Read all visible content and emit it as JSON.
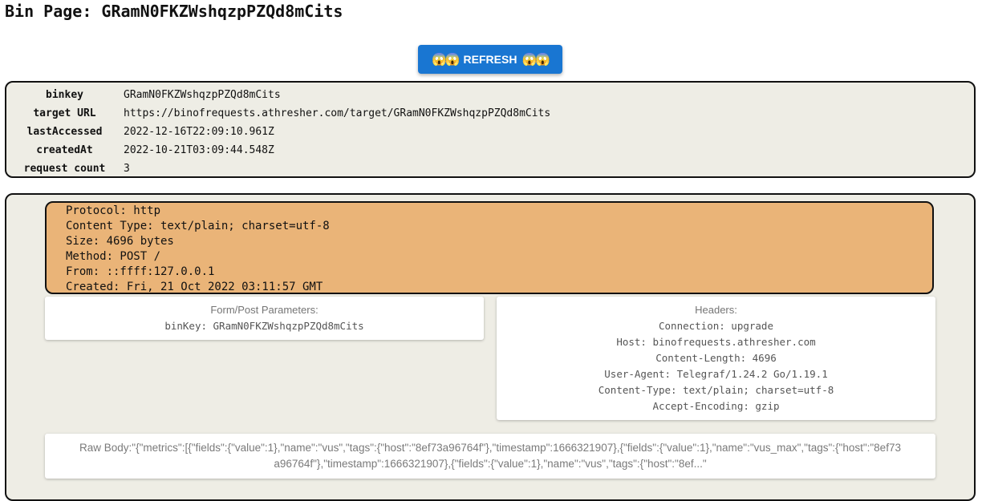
{
  "page_title": "Bin Page: GRamN0FKZWshqzpPZQd8mCits",
  "refresh_button": {
    "emoji": "😱😱",
    "label": "REFRESH"
  },
  "bin_info": [
    {
      "label": "binkey",
      "value": "GRamN0FKZWshqzpPZQd8mCits"
    },
    {
      "label": "target URL",
      "value": "https://binofrequests.athresher.com/target/GRamN0FKZWshqzpPZQd8mCits"
    },
    {
      "label": "lastAccessed",
      "value": "2022-12-16T22:09:10.961Z"
    },
    {
      "label": "createdAt",
      "value": "2022-10-21T03:09:44.548Z"
    },
    {
      "label": "request count",
      "value": "3"
    }
  ],
  "request": {
    "summary": [
      "Protocol: http",
      "Content Type: text/plain; charset=utf-8",
      "Size: 4696 bytes",
      "Method: POST /",
      "From: ::ffff:127.0.0.1",
      "Created: Fri, 21 Oct 2022 03:11:57 GMT"
    ],
    "form_params": {
      "title": "Form/Post Parameters:",
      "items": [
        "binKey: GRamN0FKZWshqzpPZQd8mCits"
      ]
    },
    "headers": {
      "title": "Headers:",
      "items": [
        "Connection: upgrade",
        "Host: binofrequests.athresher.com",
        "Content-Length: 4696",
        "User-Agent: Telegraf/1.24.2 Go/1.19.1",
        "Content-Type: text/plain; charset=utf-8",
        "Accept-Encoding: gzip"
      ]
    },
    "raw_body": "Raw Body:\"{\"metrics\":[{\"fields\":{\"value\":1},\"name\":\"vus\",\"tags\":{\"host\":\"8ef73a96764f\"},\"timestamp\":1666321907},{\"fields\":{\"value\":1},\"name\":\"vus_max\",\"tags\":{\"host\":\"8ef73a96764f\"},\"timestamp\":1666321907},{\"fields\":{\"value\":1},\"name\":\"vus\",\"tags\":{\"host\":\"8ef...\""
  }
}
